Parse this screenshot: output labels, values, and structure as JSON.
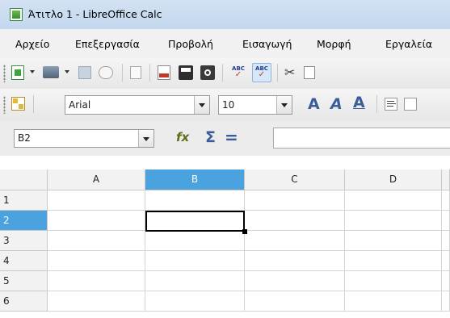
{
  "window": {
    "title": "Άτιτλο 1 - LibreOffice Calc",
    "icon": "calc-spreadsheet-icon"
  },
  "menu": [
    "Αρχείο",
    "Επεξεργασία",
    "Προβολή",
    "Εισαγωγή",
    "Μορφή",
    "Εργαλεία"
  ],
  "toolbar_standard": [
    "new-document-icon",
    "open-icon",
    "save-icon",
    "email-icon",
    "edit-document-icon",
    "export-pdf-icon",
    "print-icon",
    "print-preview-icon",
    "spellcheck-icon",
    "autospellcheck-icon",
    "cut-icon",
    "copy-icon"
  ],
  "toolbar_format": {
    "font_name": "Arial",
    "font_size": "10",
    "icons": [
      "styles-icon",
      "bold-icon",
      "italic-icon",
      "underline-icon",
      "align-left-icon"
    ]
  },
  "formula_bar": {
    "name_box": "B2",
    "function_wizard_icon": "function-wizard-icon",
    "sum_symbol": "Σ",
    "equals_symbol": "=",
    "formula": ""
  },
  "sheet": {
    "columns": [
      "A",
      "B",
      "C",
      "D"
    ],
    "rows": [
      "1",
      "2",
      "3",
      "4",
      "5",
      "6"
    ],
    "selected_cell": "B2"
  },
  "colors": {
    "selection_header": "#4aa3df",
    "titlebar": "#c9dcf1"
  }
}
